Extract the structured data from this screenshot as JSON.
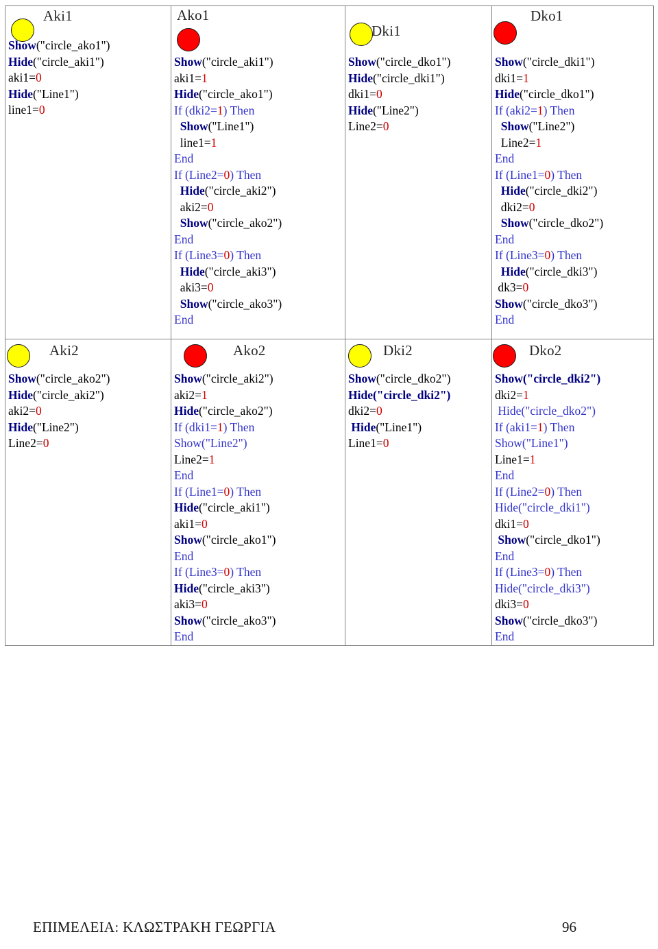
{
  "page": {
    "footer_credit": "ΕΠΙΜΕΛΕΙΑ: ΚΛΩΣΤΡΑΚΗ ΓΕΩΡΓΙΑ",
    "page_number": "96"
  },
  "colors": {
    "keyword": "#000080",
    "control": "#3333CC",
    "number": "#D00000",
    "text": "#000000",
    "dot_yellow": "#FFFF00",
    "dot_red": "#FE0000",
    "grid_line": "#808080"
  },
  "cells": [
    {
      "id": "aki1",
      "title": "Aki1",
      "dot": "yellow",
      "header_layout": "dot-left-title-right",
      "code": "Show(\"circle_ako1\")\nHide(\"circle_aki1\")\naki1=0\nHide(\"Line1\")\nline1=0"
    },
    {
      "id": "ako1",
      "title": "Ako1",
      "dot": "red",
      "header_layout": "title-above-dot",
      "code": "Show(\"circle_aki1\")\naki1=1\nHide(\"circle_ako1\")\nIf (dki2=1) Then\n  Show(\"Line1\")\n  line1=1\nEnd\nIf (Line2=0) Then\n  Hide(\"circle_aki2\")\n  aki2=0\n  Show(\"circle_ako2\")\nEnd\nIf (Line3=0) Then\n  Hide(\"circle_aki3\")\n  aki3=0\n  Show(\"circle_ako3\")\nEnd"
    },
    {
      "id": "dki1",
      "title": "Dki1",
      "dot": "yellow",
      "header_layout": "dot-inline-title",
      "code": "Show(\"circle_dko1\")\nHide(\"circle_dki1\")\ndki1=0\nHide(\"Line2\")\nLine2=0"
    },
    {
      "id": "dko1",
      "title": "Dko1",
      "dot": "red",
      "header_layout": "dot-left-title-right",
      "code": "Show(\"circle_dki1\")\ndki1=1\nHide(\"circle_dko1\")\nIf (aki2=1) Then\n  Show(\"Line2\")\n  Line2=1\nEnd\nIf (Line1=0) Then\n  Hide(\"circle_dki2\")\n  dki2=0\n  Show(\"circle_dko2\")\nEnd\nIf (Line3=0) Then\n  Hide(\"circle_dki3\")\n dk3=0\nShow(\"circle_dko3\")\nEnd"
    },
    {
      "id": "aki2",
      "title": "Aki2",
      "dot": "yellow",
      "header_layout": "dot-left-title-right",
      "code": "Show(\"circle_ako2\")\nHide(\"circle_aki2\")\naki2=0\nHide(\"Line2\")\nLine2=0"
    },
    {
      "id": "ako2",
      "title": "Ako2",
      "dot": "red",
      "header_layout": "dot-left-title-right",
      "code": "Show(\"circle_aki2\")\naki2=1\nHide(\"circle_ako2\")\nIf (dki1=1) Then\nShow(\"Line2\")\nLine2=1\nEnd\nIf (Line1=0) Then\nHide(\"circle_aki1\")\naki1=0\nShow(\"circle_ako1\")\nEnd\nIf (Line3=0) Then\nHide(\"circle_aki3\")\naki3=0\nShow(\"circle_ako3\")\nEnd"
    },
    {
      "id": "dki2",
      "title": "Dki2",
      "dot": "yellow",
      "header_layout": "dot-left-title-right",
      "code": "Show(\"circle_dko2\")\nHide(\"circle_dki2\")\ndki2=0\n Hide(\"Line1\")\nLine1=0"
    },
    {
      "id": "dko2",
      "title": "Dko2",
      "dot": "red",
      "header_layout": "dot-left-title-right",
      "code": "Show(\"circle_dki2\")\ndki2=1\n Hide(\"circle_dko2\")\nIf (aki1=1) Then\nShow(\"Line1\")\nLine1=1\nEnd\nIf (Line2=0) Then\nHide(\"circle_dki1\")\ndki1=0\n Show(\"circle_dko1\")\nEnd\nIf (Line3=0) Then\nHide(\"circle_dki3\")\ndki3=0\nShow(\"circle_dko3\")\nEnd"
    }
  ]
}
